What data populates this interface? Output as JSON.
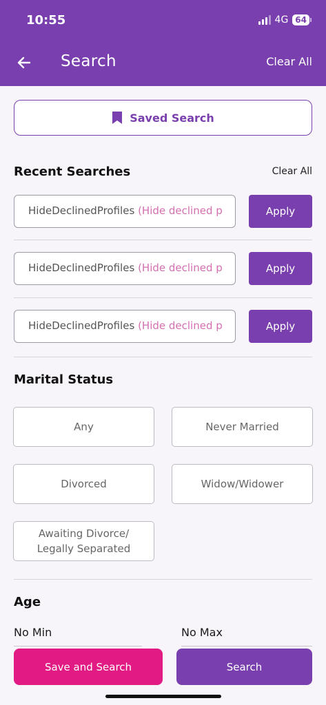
{
  "status_bar": {
    "time": "10:55",
    "network": "4G",
    "battery": "64"
  },
  "header": {
    "title": "Search",
    "clear_all": "Clear All"
  },
  "saved_search": {
    "label": "Saved Search"
  },
  "recent_searches": {
    "title": "Recent Searches",
    "clear_all": "Clear All",
    "items": [
      {
        "name": "HideDeclinedProfiles",
        "desc": "(Hide declined p",
        "apply": "Apply"
      },
      {
        "name": "HideDeclinedProfiles",
        "desc": "(Hide declined p",
        "apply": "Apply"
      },
      {
        "name": "HideDeclinedProfiles",
        "desc": "(Hide declined p",
        "apply": "Apply"
      }
    ]
  },
  "marital_status": {
    "title": "Marital Status",
    "options": [
      "Any",
      "Never Married",
      "Divorced",
      "Widow/Widower",
      "Awaiting Divorce/",
      "Legally Separated"
    ]
  },
  "age": {
    "title": "Age",
    "min": "No Min",
    "max": "No Max"
  },
  "actions": {
    "save_and_search": "Save and Search",
    "search": "Search"
  },
  "colors": {
    "primary": "#7a3fae",
    "accent": "#e21a83",
    "background": "#f7f4fa"
  }
}
